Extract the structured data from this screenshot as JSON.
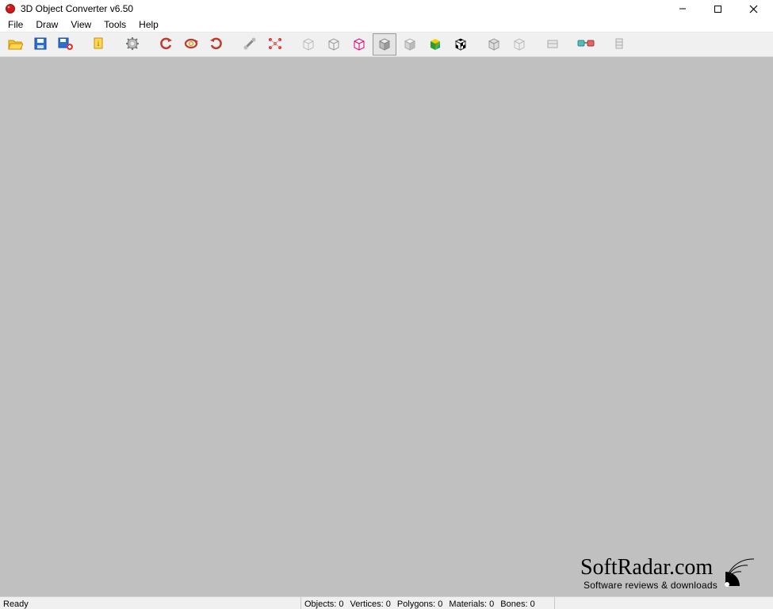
{
  "window": {
    "title": "3D Object Converter v6.50"
  },
  "menu": {
    "items": [
      "File",
      "Draw",
      "View",
      "Tools",
      "Help"
    ]
  },
  "toolbar": {
    "buttons": [
      {
        "name": "open-icon"
      },
      {
        "name": "save-icon"
      },
      {
        "name": "save-as-icon"
      },
      {
        "sep": true
      },
      {
        "name": "info-icon"
      },
      {
        "sep": true
      },
      {
        "name": "settings-icon"
      },
      {
        "sep": true
      },
      {
        "name": "rotate-left-icon"
      },
      {
        "name": "rotate-icon"
      },
      {
        "name": "rotate-right-icon"
      },
      {
        "sep": true
      },
      {
        "name": "tool-a-icon"
      },
      {
        "name": "tool-b-icon"
      },
      {
        "sep": true
      },
      {
        "name": "wire-1-icon"
      },
      {
        "name": "wire-2-icon"
      },
      {
        "name": "wire-3-icon"
      },
      {
        "name": "shaded-1-icon",
        "pressed": true
      },
      {
        "name": "shaded-2-icon"
      },
      {
        "name": "color-cube-icon"
      },
      {
        "name": "checker-cube-icon"
      },
      {
        "sep": true
      },
      {
        "name": "cube-a-icon"
      },
      {
        "name": "cube-b-icon"
      },
      {
        "sep": true
      },
      {
        "name": "misc-1-icon"
      },
      {
        "sep": true
      },
      {
        "name": "glasses-icon"
      },
      {
        "sep": true
      },
      {
        "name": "misc-2-icon"
      }
    ]
  },
  "status": {
    "ready": "Ready",
    "objects_label": "Objects:",
    "objects": 0,
    "vertices_label": "Vertices:",
    "vertices": 0,
    "polygons_label": "Polygons:",
    "polygons": 0,
    "materials_label": "Materials:",
    "materials": 0,
    "bones_label": "Bones:",
    "bones": 0
  },
  "watermark": {
    "main": "SoftRadar.com",
    "sub": "Software reviews & downloads"
  }
}
